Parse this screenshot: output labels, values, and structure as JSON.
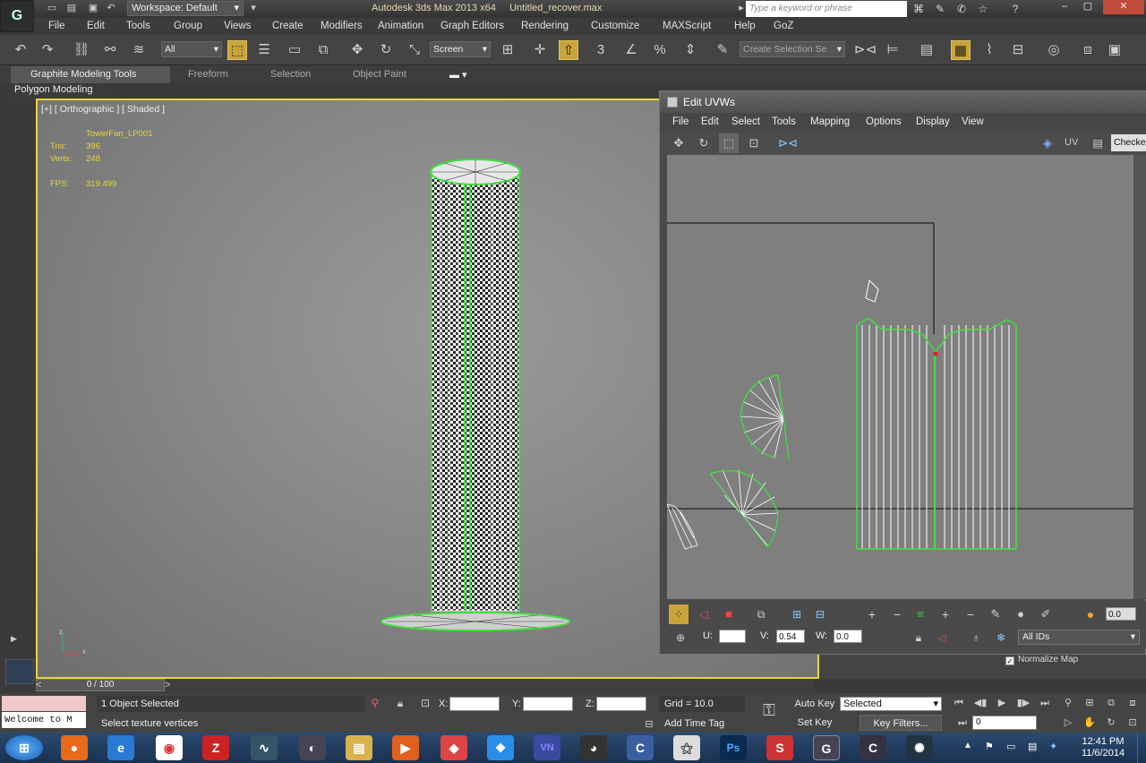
{
  "titlebar": {
    "workspace": "Workspace: Default",
    "app_title": "Autodesk 3ds Max 2013 x64",
    "file_name": "Untitled_recover.max",
    "search_placeholder": "Type a keyword or phrase"
  },
  "menus": [
    "File",
    "Edit",
    "Tools",
    "Group",
    "Views",
    "Create",
    "Modifiers",
    "Animation",
    "Graph Editors",
    "Rendering",
    "Customize",
    "MAXScript",
    "Help",
    "GoZ"
  ],
  "toolbar": {
    "filter_select": "All",
    "reference_coord": "Screen",
    "selection_set_placeholder": "Create Selection Se"
  },
  "ribbon": {
    "tabs": [
      "Graphite Modeling Tools",
      "Freeform",
      "Selection",
      "Object Paint"
    ],
    "panel_label": "Polygon Modeling"
  },
  "viewport": {
    "label": "[+] [ Orthographic ] [ Shaded ]",
    "object_name": "TowerFan_LP001",
    "tris_label": "Tris:",
    "tris_value": "396",
    "verts_label": "Verts:",
    "verts_value": "248",
    "fps_label": "FPS:",
    "fps_value": "319.499"
  },
  "uv_editor": {
    "title": "Edit UVWs",
    "menus": [
      "File",
      "Edit",
      "Select",
      "Tools",
      "Mapping",
      "Options",
      "Display",
      "View"
    ],
    "uv_label": "UV",
    "checker_label": "Checke",
    "u_label": "U:",
    "v_label": "V:",
    "v_value": "0.54",
    "w_label": "W:",
    "w_value": "0.0",
    "spinner_value": "0.0",
    "ids_select": "All IDs",
    "normalize_label": "Normalize Map"
  },
  "timeline": {
    "frame": "0 / 100"
  },
  "status": {
    "selected_text": "1 Object Selected",
    "prompt": "Select texture vertices",
    "welcome": "Welcome to M",
    "x_label": "X:",
    "y_label": "Y:",
    "z_label": "Z:",
    "grid": "Grid = 10.0",
    "add_time_tag": "Add Time Tag",
    "auto_key": "Auto Key",
    "set_key": "Set Key",
    "key_mode": "Selected",
    "key_filters": "Key Filters...",
    "frame_field": "0"
  },
  "taskbar": {
    "time": "12:41 PM",
    "date": "11/6/2014"
  },
  "colors": {
    "viewport_border": "#e8d43c",
    "stat_text": "#e8d43c",
    "wire_green": "#40e040",
    "wire_white": "#ffffff"
  }
}
